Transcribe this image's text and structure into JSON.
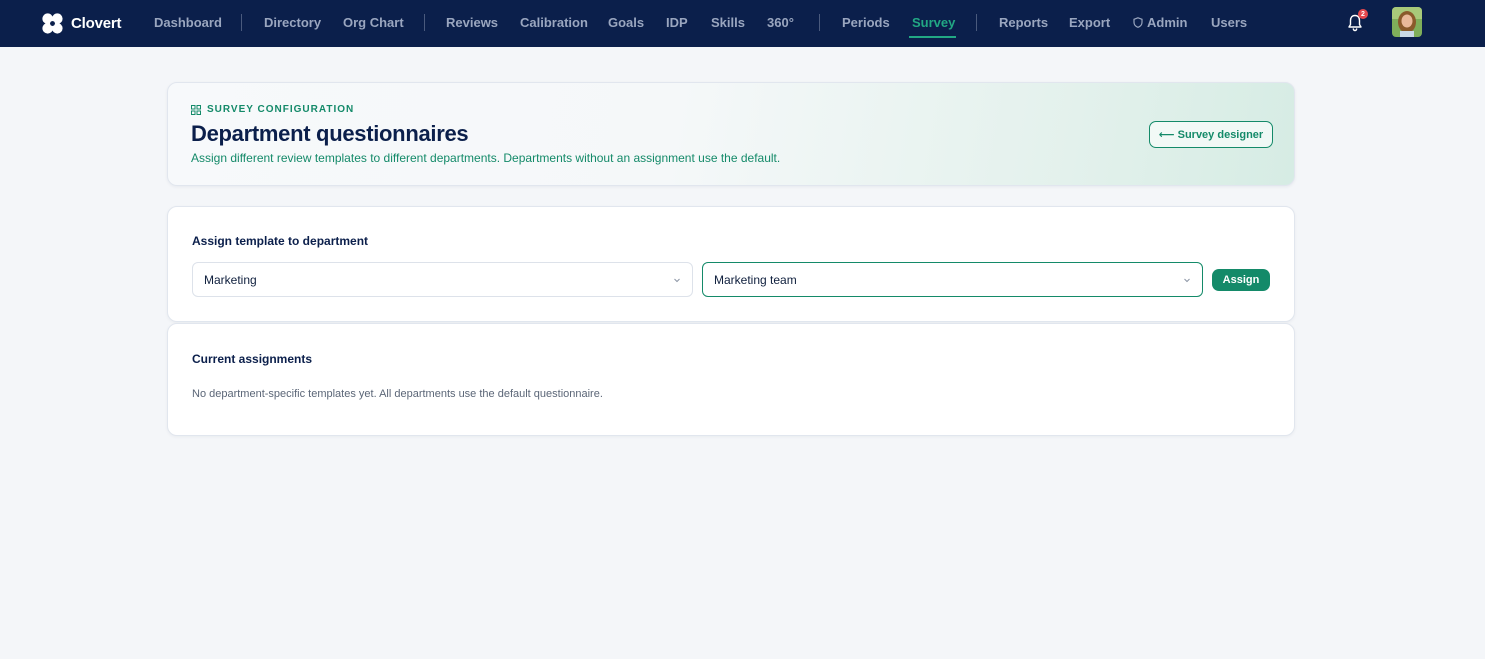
{
  "brand": {
    "name": "Clovert"
  },
  "nav": {
    "items": [
      {
        "label": "Dashboard"
      },
      {
        "label": "Directory"
      },
      {
        "label": "Org Chart"
      },
      {
        "label": "Reviews"
      },
      {
        "label": "Calibration"
      },
      {
        "label": "Goals"
      },
      {
        "label": "IDP"
      },
      {
        "label": "Skills"
      },
      {
        "label": "360°"
      },
      {
        "label": "Periods"
      },
      {
        "label": "Survey"
      },
      {
        "label": "Reports"
      },
      {
        "label": "Export"
      },
      {
        "label": "Admin"
      },
      {
        "label": "Users"
      }
    ],
    "active": "Survey",
    "notifications_count": "2"
  },
  "hero": {
    "eyebrow": "SURVEY CONFIGURATION",
    "title": "Department questionnaires",
    "subtitle": "Assign different review templates to different departments. Departments without an assignment use the default.",
    "back_button": "⟵ Survey designer"
  },
  "assign_card": {
    "title": "Assign template to department",
    "department_value": "Marketing",
    "template_value": "Marketing team",
    "assign_button": "Assign"
  },
  "current_card": {
    "title": "Current assignments",
    "empty_text": "No department-specific templates yet. All departments use the default questionnaire."
  },
  "colors": {
    "nav_bg": "#0b1f4b",
    "accent": "#148a69",
    "active_nav": "#22a884",
    "badge": "#e5484d"
  }
}
